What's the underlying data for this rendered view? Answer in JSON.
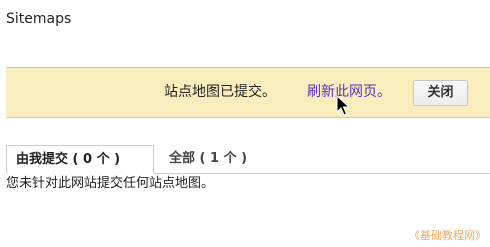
{
  "header": {
    "title": "Sitemaps"
  },
  "notice": {
    "message": "站点地图已提交。",
    "refresh_link": "刷新此网页。",
    "close_label": "关闭"
  },
  "tabs": [
    {
      "label": "由我提交 ( 0 个 )",
      "active": true
    },
    {
      "label": "全部 ( 1 个 )",
      "active": false
    }
  ],
  "content": {
    "empty_message": "您未针对此网站提交任何站点地图。"
  },
  "watermark": {
    "text": "《基础教程网》"
  },
  "colors": {
    "notice_bg": "#f9edbe",
    "notice_border": "#f0c36d",
    "link": "#5a2fbd",
    "watermark": "#f0a860"
  },
  "icons": {
    "cursor": "mouse-pointer-icon"
  }
}
